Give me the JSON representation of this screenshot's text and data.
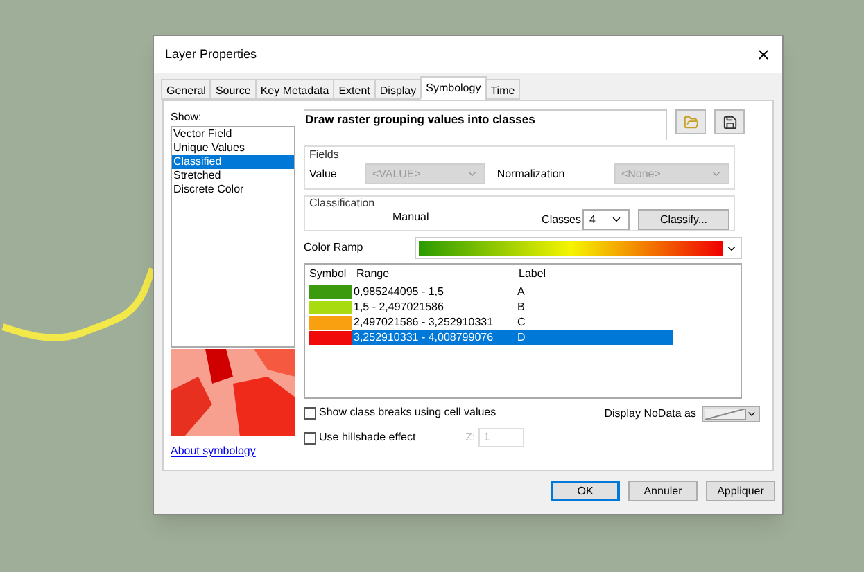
{
  "window": {
    "title": "Layer Properties"
  },
  "tabs": [
    {
      "label": "General",
      "selected": false
    },
    {
      "label": "Source",
      "selected": false
    },
    {
      "label": "Key Metadata",
      "selected": false
    },
    {
      "label": "Extent",
      "selected": false
    },
    {
      "label": "Display",
      "selected": false
    },
    {
      "label": "Symbology",
      "selected": true
    },
    {
      "label": "Time",
      "selected": false
    }
  ],
  "show": {
    "label": "Show:",
    "items": [
      {
        "label": "Vector Field",
        "selected": false
      },
      {
        "label": "Unique Values",
        "selected": false
      },
      {
        "label": "Classified",
        "selected": true
      },
      {
        "label": "Stretched",
        "selected": false
      },
      {
        "label": "Discrete Color",
        "selected": false
      }
    ]
  },
  "about_link": "About symbology",
  "description": "Draw raster grouping values into classes",
  "fields": {
    "title": "Fields",
    "value_label": "Value",
    "value": "<VALUE>",
    "normalization_label": "Normalization",
    "normalization": "<None>",
    "disabled": true
  },
  "classification": {
    "title": "Classification",
    "method": "Manual",
    "classes_label": "Classes",
    "classes": "4",
    "classify_button": "Classify..."
  },
  "color_ramp": {
    "label": "Color Ramp"
  },
  "table": {
    "columns": [
      "Symbol",
      "Range",
      "Label"
    ],
    "rows": [
      {
        "color": "#3c9a0e",
        "range": "0,985244095 - 1,5",
        "label": "A",
        "selected": false
      },
      {
        "color": "#a8dc10",
        "range": "1,5 - 2,497021586",
        "label": "B",
        "selected": false
      },
      {
        "color": "#f8a010",
        "range": "2,497021586 - 3,252910331",
        "label": "C",
        "selected": false
      },
      {
        "color": "#f00a0a",
        "range": "3,252910331 - 4,008799076",
        "label": "D",
        "selected": true
      }
    ]
  },
  "options": [
    {
      "label": "Show class breaks using cell values",
      "checked": false
    },
    {
      "label": "Use hillshade effect",
      "checked": false
    }
  ],
  "z": {
    "label": "Z:",
    "value": "1",
    "disabled": true
  },
  "nodata_label": "Display NoData as",
  "buttons": [
    {
      "label": "OK",
      "default": true
    },
    {
      "label": "Annuler",
      "default": false
    },
    {
      "label": "Appliquer",
      "default": false
    }
  ]
}
